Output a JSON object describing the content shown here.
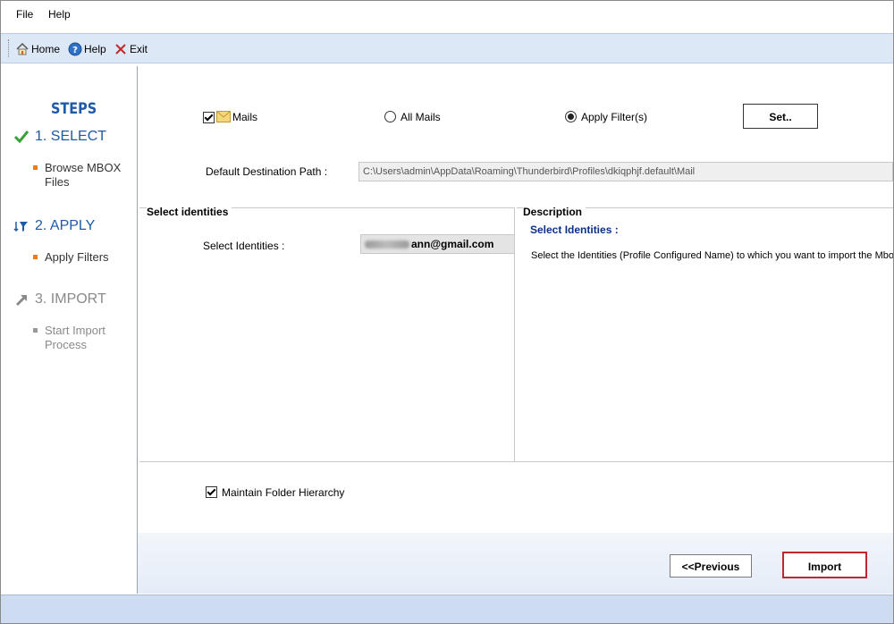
{
  "menu": {
    "file": "File",
    "help": "Help"
  },
  "toolbar": {
    "home": "Home",
    "help": "Help",
    "exit": "Exit"
  },
  "sidebar": {
    "title": "STEPS",
    "steps": [
      {
        "label": "1. SELECT",
        "sub": "Browse MBOX Files",
        "state": "done"
      },
      {
        "label": "2. APPLY",
        "sub": "Apply Filters",
        "state": "active"
      },
      {
        "label": "3. IMPORT",
        "sub": "Start Import Process",
        "state": "pending"
      }
    ]
  },
  "options": {
    "mails_label": "Mails",
    "mails_checked": true,
    "all_mails_label": "All Mails",
    "apply_filters_label": "Apply Filter(s)",
    "selected_radio": "apply_filters",
    "set_button": "Set.."
  },
  "destination": {
    "label": "Default Destination Path :",
    "value": "C:\\Users\\admin\\AppData\\Roaming\\Thunderbird\\Profiles\\dkiqphjf.default\\Mail"
  },
  "identities": {
    "panel_title": "Select identities",
    "field_label": "Select Identities :",
    "value_visible": "ann@gmail.com"
  },
  "description": {
    "panel_title": "Description",
    "heading": "Select Identities :",
    "text": "Select the Identities (Profile Configured Name) to  which  you want to import the Mbox"
  },
  "hierarchy": {
    "label": "Maintain Folder Hierarchy",
    "checked": true
  },
  "nav": {
    "previous": "<<Previous",
    "import": "Import"
  },
  "colors": {
    "accent_blue": "#1e5aa8",
    "step_done_green": "#3aa03a",
    "bullet_orange": "#e87d1e",
    "import_border": "#c0282d"
  }
}
